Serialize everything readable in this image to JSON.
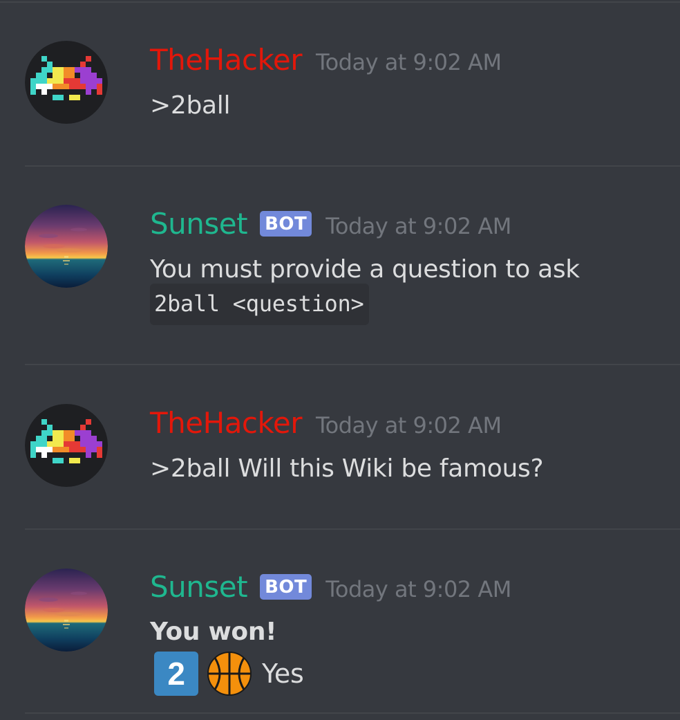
{
  "colors": {
    "background": "#36393f",
    "hacker_name": "#e3170a",
    "bot_name": "#1fb78f",
    "bot_tag": "#7289da",
    "timestamp": "#72767d",
    "text": "#dcddde"
  },
  "messages": [
    {
      "author": "TheHacker",
      "timestamp": "Today at 9:02 AM",
      "text": ">2ball",
      "avatar": "space-invader-icon"
    },
    {
      "author": "Sunset",
      "bot_tag": "BOT",
      "timestamp": "Today at 9:02 AM",
      "text": "You must provide a question to ask",
      "code": "2ball <question>",
      "avatar": "sunset-icon"
    },
    {
      "author": "TheHacker",
      "timestamp": "Today at 9:02 AM",
      "text": ">2ball Will this Wiki be famous?",
      "avatar": "space-invader-icon"
    },
    {
      "author": "Sunset",
      "bot_tag": "BOT",
      "timestamp": "Today at 9:02 AM",
      "title": "You won!",
      "number_emoji": "2",
      "ball_emoji": "basketball-icon",
      "answer": "Yes",
      "avatar": "sunset-icon"
    }
  ]
}
